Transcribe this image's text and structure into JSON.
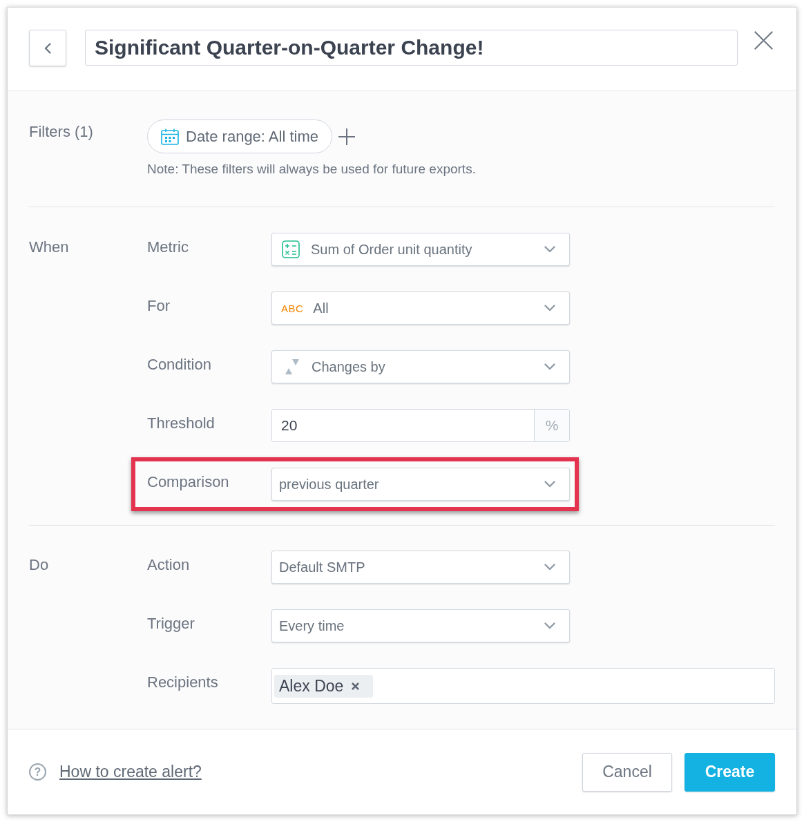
{
  "dialog": {
    "title": "Significant Quarter-on-Quarter Change!"
  },
  "filters": {
    "label": "Filters (1)",
    "chips": [
      {
        "label": "Date range: All time"
      }
    ],
    "note": "Note: These filters will always be used for future exports."
  },
  "sections": [
    {
      "label": "When",
      "fields": [
        {
          "kind": "metric",
          "label": "Metric",
          "value": "Sum of Order unit quantity",
          "highlighted": false
        },
        {
          "kind": "attribute",
          "label": "For",
          "badge": "ABC",
          "value": "All",
          "highlighted": false
        },
        {
          "kind": "condition",
          "label": "Condition",
          "value": "Changes by",
          "highlighted": false
        },
        {
          "kind": "number",
          "label": "Threshold",
          "value": "20",
          "unit": "%",
          "highlighted": false
        },
        {
          "kind": "select",
          "label": "Comparison",
          "value": "previous quarter",
          "highlighted": true
        }
      ]
    },
    {
      "label": "Do",
      "fields": [
        {
          "kind": "select",
          "label": "Action",
          "value": "Default SMTP",
          "highlighted": false
        },
        {
          "kind": "select",
          "label": "Trigger",
          "value": "Every time",
          "highlighted": false
        },
        {
          "kind": "tags",
          "label": "Recipients",
          "tags": [
            {
              "label": "Alex Doe"
            }
          ],
          "highlighted": false
        }
      ]
    }
  ],
  "footer": {
    "help_glyph": "?",
    "link": "How to create alert?",
    "buttons": [
      {
        "label": "Cancel",
        "kind": "secondary"
      },
      {
        "label": "Create",
        "kind": "primary"
      }
    ]
  }
}
